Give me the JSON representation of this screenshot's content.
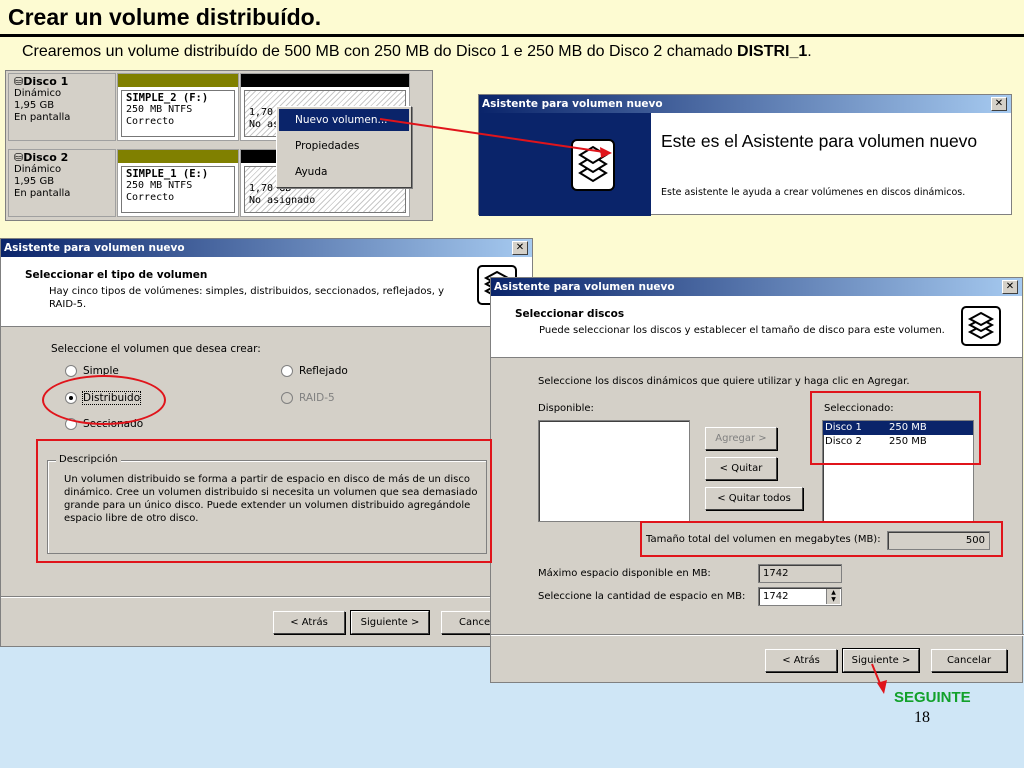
{
  "slide": {
    "title": "Crear un volume distribuído.",
    "subtitle_text": "Crearemos un volume distribuído de 500 MB con 250 MB do Disco 1 e 250 MB do Disco 2 chamado ",
    "subtitle_bold": "DISTRI_1",
    "subtitle_end": ".",
    "page_number": "18",
    "next_label": "SEGUINTE"
  },
  "disk_panel": {
    "disks": [
      {
        "name": "Disco 1",
        "type": "Dinámico",
        "size": "1,95 GB",
        "status": "En pantalla",
        "volume": {
          "name": "SIMPLE_2 (F:)",
          "fs": "250 MB NTFS",
          "state": "Correcto"
        },
        "unalloc": {
          "size": "1,70",
          "state": "No as"
        }
      },
      {
        "name": "Disco 2",
        "type": "Dinámico",
        "size": "1,95 GB",
        "status": "En pantalla",
        "volume": {
          "name": "SIMPLE_1 (E:)",
          "fs": "250 MB NTFS",
          "state": "Correcto"
        },
        "unalloc": {
          "size": "1,70 GB",
          "state": "No asignado"
        }
      }
    ],
    "context_menu": [
      "Nuevo volumen...",
      "Propiedades",
      "Ayuda"
    ]
  },
  "welcome_window": {
    "title": "Asistente para volumen nuevo",
    "heading": "Este es el Asistente para volumen nuevo",
    "description": "Este asistente le ayuda a crear volúmenes en discos dinámicos."
  },
  "wizard_type": {
    "title": "Asistente para volumen nuevo",
    "header_title": "Seleccionar el tipo de volumen",
    "header_desc": "Hay cinco tipos de volúmenes: simples, distribuidos, seccionados, reflejados, y RAID-5.",
    "prompt": "Seleccione el volumen que desea crear:",
    "options": {
      "simple": "Simple",
      "distribuido": "Distribuido",
      "seccionado": "Seccionado",
      "reflejado": "Reflejado",
      "raid5": "RAID-5"
    },
    "description_legend": "Descripción",
    "description_text": "Un volumen distribuido se forma a partir de espacio en disco de más de un disco dinámico. Cree un volumen distribuido si necesita un volumen que sea demasiado grande para un único disco. Puede extender un volumen distribuido agregándole espacio libre de otro disco.",
    "buttons": {
      "back": "< Atrás",
      "next": "Siguiente >",
      "cancel": "Cance"
    }
  },
  "wizard_disks": {
    "title": "Asistente para volumen nuevo",
    "header_title": "Seleccionar discos",
    "header_desc": "Puede seleccionar los discos y establecer el tamaño de disco para este volumen.",
    "instruction": "Seleccione los discos dinámicos que quiere utilizar y haga clic en Agregar.",
    "available_label": "Disponible:",
    "selected_label": "Seleccionado:",
    "selected_items": [
      {
        "disk": "Disco 1",
        "size": "250 MB"
      },
      {
        "disk": "Disco 2",
        "size": "250 MB"
      }
    ],
    "add_button": "Agregar >",
    "remove_button": "< Quitar",
    "remove_all_button": "< Quitar todos",
    "total_label": "Tamaño total del volumen en megabytes (MB):",
    "total_value": "500",
    "max_label": "Máximo espacio disponible en MB:",
    "max_value": "1742",
    "amount_label": "Seleccione la cantidad de espacio en MB:",
    "amount_value": "1742",
    "buttons": {
      "back": "< Atrás",
      "next": "Siguiente >",
      "cancel": "Cancelar"
    }
  },
  "colors": {
    "annotation_red": "#e0141b",
    "next_green": "#12a12b",
    "titlebar_blue": "#0a246a"
  }
}
